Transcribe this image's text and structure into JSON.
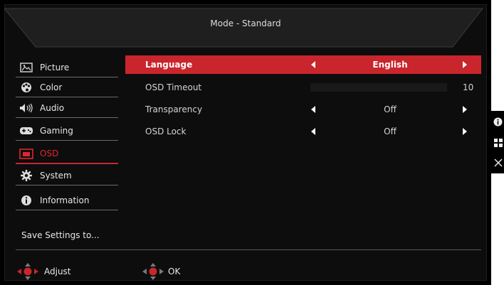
{
  "header": {
    "title": "Mode - Standard"
  },
  "sidebar": {
    "items": [
      {
        "label": "Picture",
        "icon": "picture-icon"
      },
      {
        "label": "Color",
        "icon": "palette-icon"
      },
      {
        "label": "Audio",
        "icon": "speaker-icon"
      },
      {
        "label": "Gaming",
        "icon": "gamepad-icon"
      },
      {
        "label": "OSD",
        "icon": "osd-icon"
      },
      {
        "label": "System",
        "icon": "gear-icon"
      },
      {
        "label": "Information",
        "icon": "info-icon"
      }
    ],
    "active": "OSD",
    "save_label": "Save Settings to..."
  },
  "settings": {
    "language": {
      "label": "Language",
      "value": "English"
    },
    "osd_timeout": {
      "label": "OSD Timeout",
      "value": "10"
    },
    "transparency": {
      "label": "Transparency",
      "value": "Off"
    },
    "osd_lock": {
      "label": "OSD Lock",
      "value": "Off"
    }
  },
  "footer": {
    "adjust_label": "Adjust",
    "ok_label": "OK"
  },
  "right_panel": {
    "icons": [
      "info-icon",
      "menu-grid-icon",
      "close-icon"
    ]
  },
  "colors": {
    "accent": "#c9252c",
    "background": "#000000",
    "text": "#e6e6e6"
  }
}
